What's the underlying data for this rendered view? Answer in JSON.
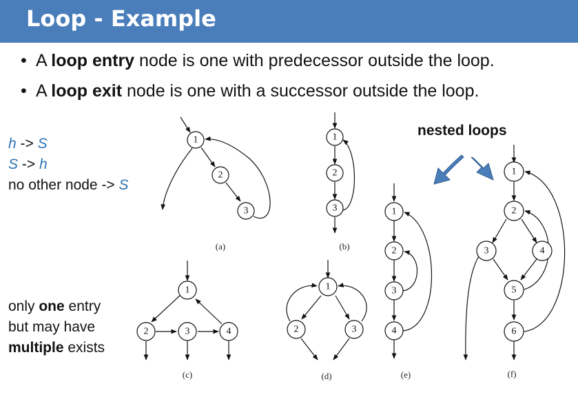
{
  "title": "Loop - Example",
  "bullets": [
    {
      "prefix": "A ",
      "bold": "loop entry",
      "suffix": " node is one with predecessor outside the loop."
    },
    {
      "prefix": "A ",
      "bold": "loop exit",
      "suffix": " node is one with a successor outside the loop."
    }
  ],
  "notes_top": {
    "line1_a": "h",
    "line1_b": " -> ",
    "line1_c": "S",
    "line2_a": "S",
    "line2_b": " -> ",
    "line2_c": "h",
    "line3_a": "no other node -> ",
    "line3_b": "S"
  },
  "notes_bottom": {
    "line1_a": "only ",
    "line1_b": "one",
    "line1_c": " entry",
    "line2": "but may have",
    "line3_a": "multiple",
    "line3_b": " exists"
  },
  "nested_label": "nested loops",
  "captions": [
    "(a)",
    "(b)",
    "(c)",
    "(d)",
    "(e)",
    "(f)"
  ],
  "node_labels": {
    "a": [
      "1",
      "2",
      "3"
    ],
    "b": [
      "1",
      "2",
      "3"
    ],
    "c": [
      "1",
      "2",
      "3",
      "4"
    ],
    "d": [
      "1",
      "2",
      "3"
    ],
    "e": [
      "1",
      "2",
      "3",
      "4"
    ],
    "f": [
      "1",
      "2",
      "3",
      "4",
      "5",
      "6"
    ]
  },
  "accent_color": "#4a7ebb"
}
